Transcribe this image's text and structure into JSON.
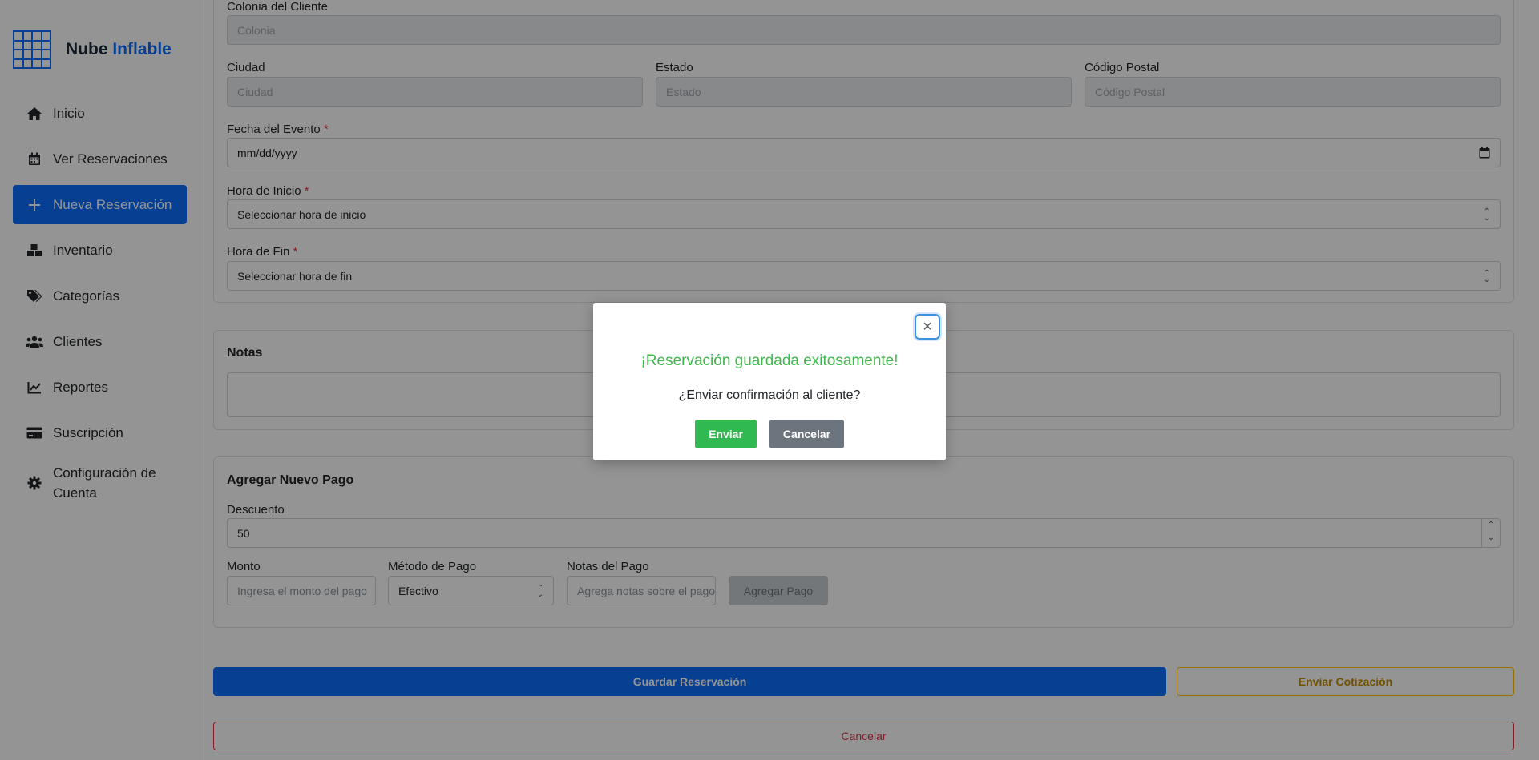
{
  "brand": {
    "name_part1": "Nube",
    "name_part2": "Inflable",
    "logo_icon": "grid-logo-icon"
  },
  "sidebar": {
    "items": [
      {
        "label": "Inicio",
        "icon": "home-icon"
      },
      {
        "label": "Ver Reservaciones",
        "icon": "calendar-icon"
      },
      {
        "label": "Nueva Reservación",
        "icon": "plus-icon",
        "active": true
      },
      {
        "label": "Inventario",
        "icon": "boxes-icon"
      },
      {
        "label": "Categorías",
        "icon": "tags-icon"
      },
      {
        "label": "Clientes",
        "icon": "users-icon"
      },
      {
        "label": "Reportes",
        "icon": "chart-line-icon"
      },
      {
        "label": "Suscripción",
        "icon": "credit-card-icon"
      },
      {
        "label": "Configuración de Cuenta",
        "icon": "gear-icon"
      }
    ]
  },
  "form": {
    "colonia": {
      "label": "Colonia del Cliente",
      "placeholder": "Colonia"
    },
    "ciudad": {
      "label": "Ciudad",
      "placeholder": "Ciudad"
    },
    "estado": {
      "label": "Estado",
      "placeholder": "Estado"
    },
    "cp": {
      "label": "Código Postal",
      "placeholder": "Código Postal"
    },
    "fecha": {
      "label": "Fecha del Evento",
      "required": "*",
      "value": "mm/dd/yyyy"
    },
    "hora_inicio": {
      "label": "Hora de Inicio",
      "required": "*",
      "value": "Seleccionar hora de inicio"
    },
    "hora_fin": {
      "label": "Hora de Fin",
      "required": "*",
      "value": "Seleccionar hora de fin"
    }
  },
  "notes": {
    "title": "Notas"
  },
  "payment": {
    "title": "Agregar Nuevo Pago",
    "descuento": {
      "label": "Descuento",
      "value": "50"
    },
    "monto": {
      "label": "Monto",
      "placeholder": "Ingresa el monto del pago"
    },
    "metodo": {
      "label": "Método de Pago",
      "value": "Efectivo"
    },
    "notas": {
      "label": "Notas del Pago",
      "placeholder": "Agrega notas sobre el pago"
    },
    "add_label": "Agregar Pago"
  },
  "actions": {
    "save_label": "Guardar Reservación",
    "quote_label": "Enviar Cotización",
    "cancel_label": "Cancelar"
  },
  "modal": {
    "title": "¡Reservación guardada exitosamente!",
    "text": "¿Enviar confirmación al cliente?",
    "send_label": "Enviar",
    "cancel_label": "Cancelar",
    "close_glyph": "×"
  },
  "colors": {
    "primary": "#0d6efd",
    "success_text": "#3db84a",
    "success_button": "#2fb950",
    "secondary": "#6c757d",
    "warning": "#ffc107",
    "danger": "#dc3545"
  }
}
